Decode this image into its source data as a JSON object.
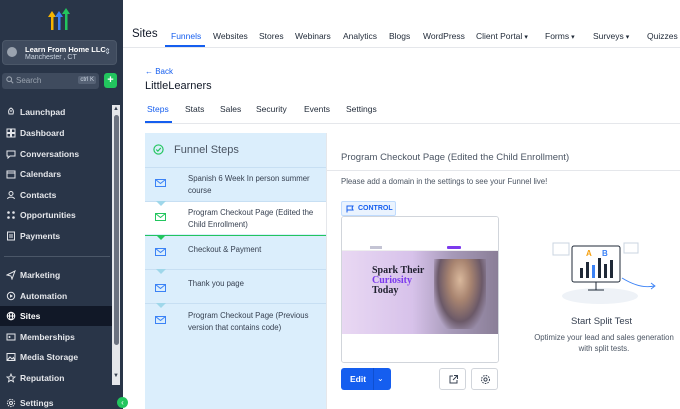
{
  "sidebar": {
    "account": {
      "name": "Learn From Home LLC",
      "location": "Manchester , CT"
    },
    "search": {
      "placeholder": "Search",
      "shortcut": "ctrl K"
    },
    "add_label": "+",
    "items": [
      {
        "label": "Launchpad",
        "icon": "rocket-icon"
      },
      {
        "label": "Dashboard",
        "icon": "grid-icon"
      },
      {
        "label": "Conversations",
        "icon": "chat-icon"
      },
      {
        "label": "Calendars",
        "icon": "calendar-icon"
      },
      {
        "label": "Contacts",
        "icon": "contacts-icon"
      },
      {
        "label": "Opportunities",
        "icon": "opportunities-icon"
      },
      {
        "label": "Payments",
        "icon": "payments-icon"
      },
      {
        "label": "Marketing",
        "icon": "send-icon"
      },
      {
        "label": "Automation",
        "icon": "automation-icon"
      },
      {
        "label": "Sites",
        "icon": "globe-icon"
      },
      {
        "label": "Memberships",
        "icon": "memberships-icon"
      },
      {
        "label": "Media Storage",
        "icon": "image-icon"
      },
      {
        "label": "Reputation",
        "icon": "star-icon"
      },
      {
        "label": "Settings",
        "icon": "gear-icon"
      }
    ],
    "active_item": "Sites"
  },
  "topbar": {
    "title": "Sites",
    "items": [
      "Funnels",
      "Websites",
      "Stores",
      "Webinars",
      "Analytics",
      "Blogs",
      "WordPress",
      "Client Portal",
      "Forms",
      "Surveys",
      "Quizzes"
    ],
    "active": "Funnels"
  },
  "main": {
    "back_label": "← Back",
    "funnel_name": "LittleLearners",
    "tabs": [
      "Steps",
      "Stats",
      "Sales",
      "Security",
      "Events",
      "Settings"
    ],
    "active_tab": "Steps"
  },
  "funnel_steps": {
    "title": "Funnel Steps",
    "steps": [
      "Spanish 6 Week In person summer course",
      "Program Checkout Page (Edited the Child Enrollment)",
      "Checkout & Payment",
      "Thank you page",
      "Program Checkout Page (Previous version that contains code)"
    ],
    "selected_index": 1
  },
  "detail": {
    "page_title": "Program Checkout Page (Edited the Child Enrollment)",
    "domain_message": "Please add a domain in the settings to see your Funnel live!",
    "control_label": "CONTROL",
    "preview": {
      "heading_line1": "Spark Their",
      "heading_line2": "Curiosity",
      "heading_line3": "Today"
    },
    "edit_label": "Edit",
    "split_test": {
      "title": "Start Split Test",
      "description": "Optimize your lead and sales generation with split tests.",
      "label_a": "A",
      "label_b": "B"
    }
  },
  "colors": {
    "primary": "#155eef",
    "sidebar_bg": "#293548",
    "steps_bg": "#dbeefc",
    "success": "#22c55e"
  }
}
